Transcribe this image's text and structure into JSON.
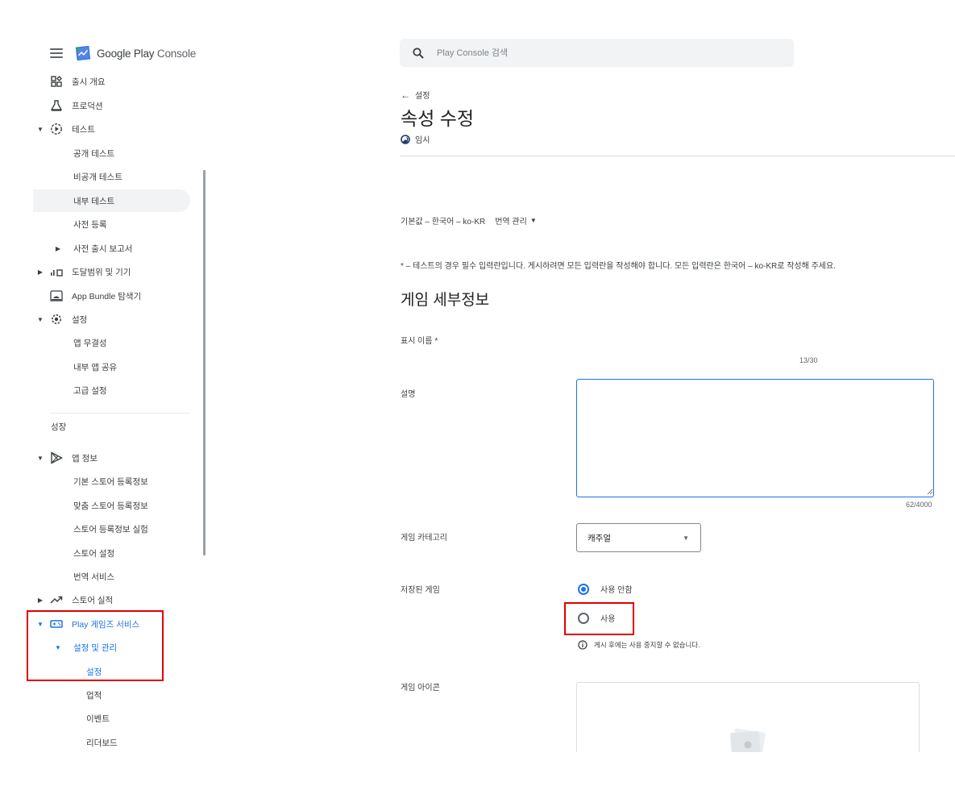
{
  "app": {
    "logo_text_main": "Google Play",
    "logo_text_sub": "Console"
  },
  "sidebar": {
    "items": [
      {
        "label": "출시 개요",
        "icon": "dashboard-icon"
      },
      {
        "label": "프로덕션",
        "icon": "production-icon"
      },
      {
        "label": "테스트",
        "icon": "test-icon",
        "expanded": true
      },
      {
        "label": "공개 테스트"
      },
      {
        "label": "비공개 테스트"
      },
      {
        "label": "내부 테스트",
        "selected_bg": true
      },
      {
        "label": "사전 등록"
      },
      {
        "label": "사전 출시 보고서",
        "collapsed": true
      },
      {
        "label": "도달범위 및 기기",
        "icon": "reach-devices-icon",
        "collapsed": true
      },
      {
        "label": "App Bundle 탐색기",
        "icon": "bundle-explorer-icon"
      },
      {
        "label": "설정",
        "icon": "settings-gear-icon",
        "expanded": true
      },
      {
        "label": "앱 무결성"
      },
      {
        "label": "내부 앱 공유"
      },
      {
        "label": "고급 설정"
      }
    ],
    "growth_section": "성장",
    "growth_items": [
      {
        "label": "앱 정보",
        "icon": "play-store-icon",
        "expanded": true
      },
      {
        "label": "기본 스토어 등록정보"
      },
      {
        "label": "맞춤 스토어 등록정보"
      },
      {
        "label": "스토어 등록정보 실험"
      },
      {
        "label": "스토어 설정"
      },
      {
        "label": "번역 서비스"
      },
      {
        "label": "스토어 실적",
        "icon": "trending-icon",
        "collapsed": true
      },
      {
        "label": "Play 게임즈 서비스",
        "icon": "gamepad-icon",
        "expanded": true,
        "active": true
      },
      {
        "label": "설정 및 관리",
        "expanded": true,
        "active": true
      },
      {
        "label": "설정",
        "active": true
      },
      {
        "label": "업적"
      },
      {
        "label": "이벤트"
      },
      {
        "label": "리더보드"
      }
    ]
  },
  "search": {
    "placeholder": "Play Console 검색"
  },
  "header": {
    "back_label": "설정",
    "title": "속성 수정",
    "status": "임시"
  },
  "language": {
    "default_label": "기본값 – 한국어 – ko-KR",
    "manage_label": "번역 관리"
  },
  "note": "* – 테스트의 경우 필수 입력란입니다. 게시하려면 모든 입력란을 작성해야 합니다. 모든 입력란은 한국어 – ko-KR로 작성해 주세요.",
  "form": {
    "section_title": "게임 세부정보",
    "display_name": {
      "label": "표시 이름 *",
      "counter": "13/30"
    },
    "description": {
      "label": "설명",
      "counter": "62/4000",
      "value": ""
    },
    "category": {
      "label": "게임 카테고리",
      "selected": "캐주얼"
    },
    "saved_games": {
      "label": "저장된 게임",
      "options": [
        {
          "label": "사용 안함",
          "checked": true
        },
        {
          "label": "사용",
          "checked": false
        }
      ],
      "info": "게시 후에는 사용 중지할 수 없습니다."
    },
    "game_icon": {
      "label": "게임 아이콘"
    }
  },
  "colors": {
    "accent": "#1a73e8",
    "highlight_box": "#e00000",
    "text": "#3c4043"
  }
}
